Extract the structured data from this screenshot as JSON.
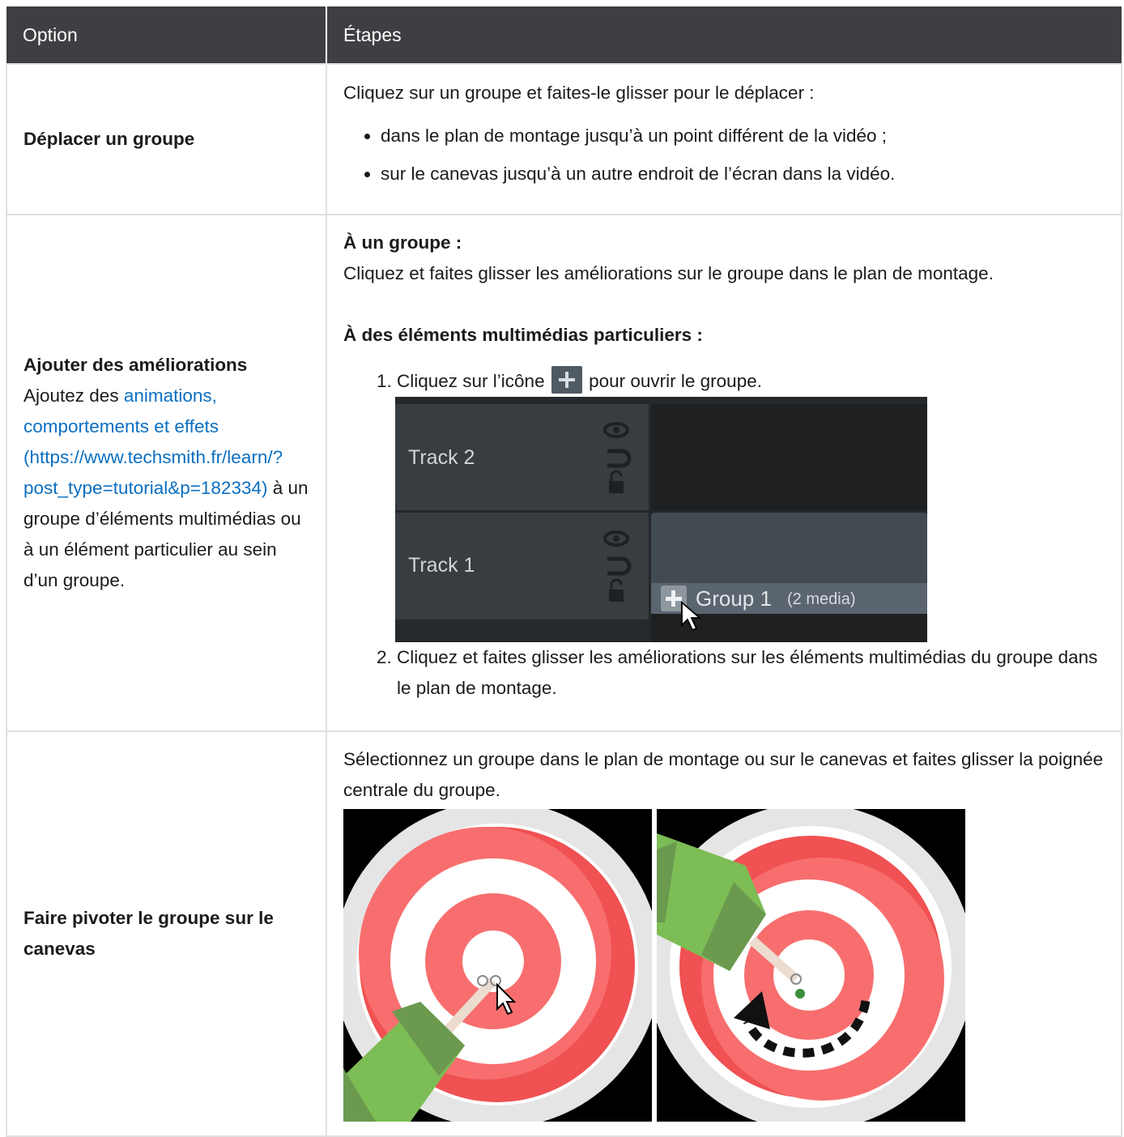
{
  "header": {
    "option": "Option",
    "steps": "Étapes"
  },
  "rows": [
    {
      "option": "Déplacer un groupe",
      "intro": "Cliquez sur un groupe et faites-le glisser pour le déplacer :",
      "bullets": [
        "dans le plan de montage jusqu’à un point différent de la vidéo ;",
        "sur le canevas jusqu’à un autre endroit de l’écran dans la vidéo."
      ]
    },
    {
      "option": "Ajouter des améliorations",
      "desc_before": "Ajoutez des ",
      "link_text": "animations, comportements et effets (https://www.techsmith.fr/learn/?post_type=tutorial&p=182334)",
      "desc_after": " à un groupe d’éléments multimédias ou à un élément particulier au sein d’un groupe.",
      "group_heading": "À un groupe :",
      "group_text": "Cliquez et faites glisser les améliorations sur le groupe dans le plan de montage.",
      "media_heading": "À des éléments multimédias particuliers :",
      "step1_before": "Cliquez sur l’icône ",
      "step1_after": " pour ouvrir le groupe.",
      "step2": "Cliquez et faites glisser les améliorations sur les éléments multimédias du groupe dans le plan de montage.",
      "timeline": {
        "track2": "Track 2",
        "track1": "Track 1",
        "group_label": "Group 1",
        "group_count": "(2 media)"
      }
    },
    {
      "option": "Faire pivoter le groupe sur le canevas",
      "text": "Sélectionnez un groupe dans le plan de montage ou sur le canevas et faites glisser la poignée centrale du groupe."
    }
  ],
  "icons": [
    "plus-icon",
    "eye-icon",
    "magnet-icon",
    "lock-icon",
    "cursor-icon",
    "rotate-arrow-icon"
  ],
  "colors": {
    "header_bg": "#3d3f42",
    "link": "#0b6fc2",
    "target_red": "#f45b5b",
    "arrow_green": "#7dbd55"
  }
}
